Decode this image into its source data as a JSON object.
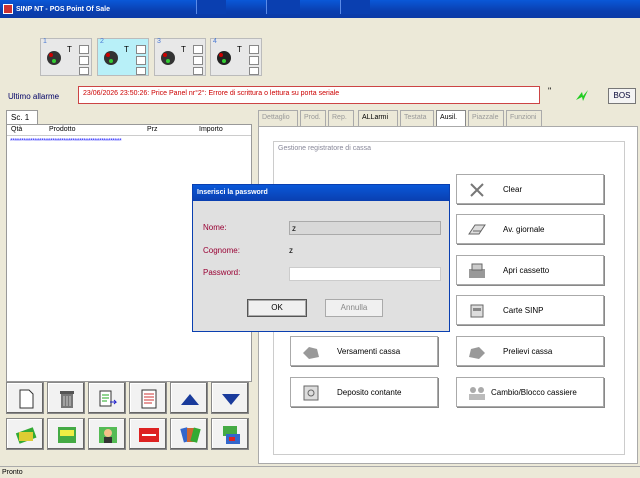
{
  "window": {
    "title": "SINP NT - POS Point Of Sale"
  },
  "panels": [
    {
      "num": "1",
      "t": "T",
      "selected": false
    },
    {
      "num": "2",
      "t": "T",
      "selected": true
    },
    {
      "num": "3",
      "t": "T",
      "selected": false
    },
    {
      "num": "4",
      "t": "T",
      "selected": false
    }
  ],
  "alarm": {
    "label": "Ultimo allarme",
    "message": "23/06/2026 23:50:26: Price Panel nr°2°: Errore di scrittura o lettura su porta seriale",
    "quote": "\"",
    "bos_label": "BOS"
  },
  "cart": {
    "tab": "Sc. 1",
    "headers": {
      "qty": "Qtà",
      "product": "Prodotto",
      "price": "Prz",
      "amount": "Importo"
    },
    "stars": "**************************************************"
  },
  "tabs": [
    "Dettaglio",
    "Prod.",
    "Rep.",
    "ALLarmi",
    "Testata",
    "Ausil.",
    "Piazzale",
    "Funzioni"
  ],
  "active_tab": "Ausil.",
  "group": {
    "label": "Gestione registratore di cassa"
  },
  "functions": {
    "clear": "Clear",
    "av_giornale": "Av. giornale",
    "apri_cassetto": "Apri cassetto",
    "carte_sinp": "Carte SINP",
    "versamenti": "Versamenti cassa",
    "prelievi": "Prelievi cassa",
    "deposito": "Deposito contante",
    "cambio": "Cambio/Blocco cassiere"
  },
  "dialog": {
    "title": "Inserisci la password",
    "nome_label": "Nome:",
    "nome_value": "z",
    "cognome_label": "Cognome:",
    "cognome_value": "z",
    "password_label": "Password:",
    "password_value": "",
    "ok": "OK",
    "cancel": "Annulla"
  },
  "status": {
    "text": "Pronto"
  },
  "colors": {
    "titlebar": "#0a3fb0",
    "alarm_text": "#cc0000",
    "label_red": "#993333"
  }
}
